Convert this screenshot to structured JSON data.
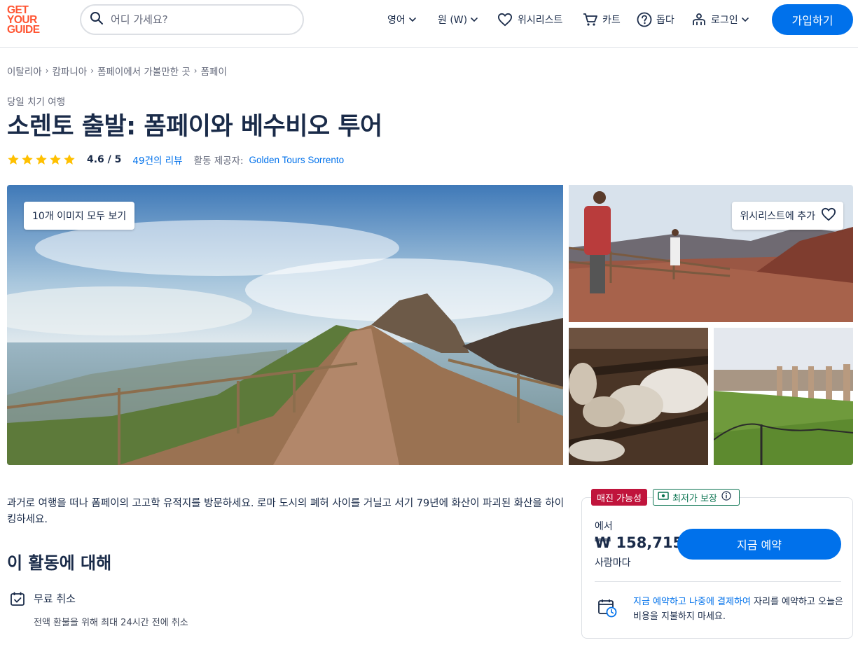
{
  "header": {
    "logo_lines": [
      "GET",
      "YOUR",
      "GUIDE"
    ],
    "search_placeholder": "어디 가세요?",
    "language": "영어",
    "currency": "원 (W)",
    "wishlist": "위시리스트",
    "cart": "카트",
    "help": "돕다",
    "login": "로그인",
    "signup": "가입하기"
  },
  "breadcrumb": [
    "이탈리아",
    "캄파니아",
    "폼페이에서 가볼만한 곳",
    "폼페이"
  ],
  "activity": {
    "category": "당일 치기 여행",
    "title": "소렌토 출발: 폼페이와 베수비오 투어",
    "rating_value": "4.6 / 5",
    "stars": 5,
    "reviews_count": "49",
    "reviews_suffix": "건의 리뷰",
    "provider_label": "활동 제공자:",
    "provider_name": "Golden Tours Sorrento"
  },
  "gallery": {
    "view_all": "10개 이미지 모두 보기",
    "add_to_wishlist": "위시리스트에 추가"
  },
  "description": "과거로 여행을 떠나 폼페이의 고고학 유적지를 방문하세요. 로마 도시의 폐허 사이를 거닐고 서기 79년에 화산이 파괴된 화산을 하이킹하세요.",
  "about": {
    "title": "이 활동에 대해",
    "features": [
      {
        "title": "무료 취소",
        "subtitle": "전액 환불을 위해 최대 24시간 전에 취소"
      }
    ]
  },
  "booking": {
    "badge_sellout": "매진 가능성",
    "badge_best_price": "최저가 보장",
    "from_label": "에서",
    "price": "₩ 158,715",
    "per_person": "사람마다",
    "book_button": "지금 예약",
    "rnpl_link": "지금 예약하고 나중에 결제하여",
    "rnpl_text": " 자리를 예약하고 오늘은 비용을 지불하지 마세요."
  },
  "colors": {
    "brand": "#ff5533",
    "primary": "#0071eb",
    "text": "#1a2b49",
    "star": "#ffc000",
    "sellout_red": "#c0143c",
    "best_price_green": "#0a7350"
  }
}
